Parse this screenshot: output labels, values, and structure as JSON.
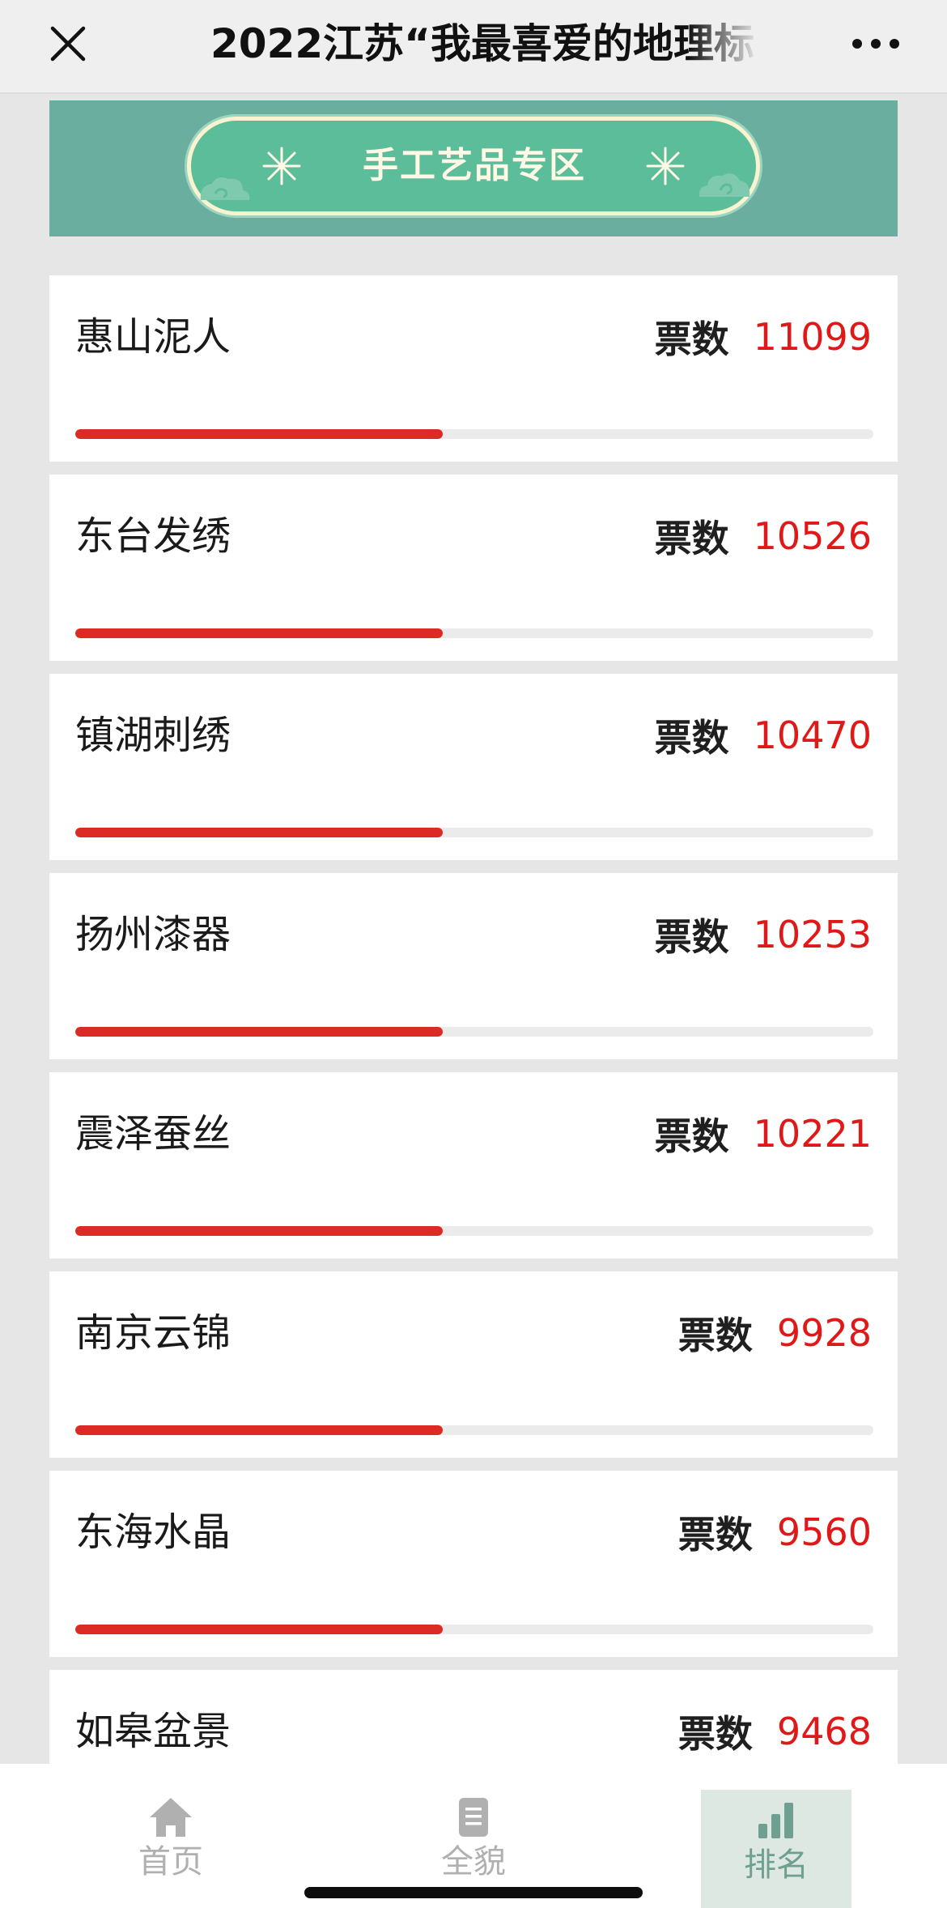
{
  "header": {
    "title": "2022江苏“我最喜爱的地理标",
    "close_icon": "close-icon",
    "more_icon": "more-icon"
  },
  "banner": {
    "title": "手工艺品专区",
    "colors": {
      "background": "#6aaea0",
      "pill": "#5bbd9a",
      "border": "#fbf2cf"
    }
  },
  "vote_label": "票数",
  "items": [
    {
      "name": "惠山泥人",
      "votes": "11099",
      "progress": 0.46
    },
    {
      "name": "东台发绣",
      "votes": "10526",
      "progress": 0.46
    },
    {
      "name": "镇湖刺绣",
      "votes": "10470",
      "progress": 0.46
    },
    {
      "name": "扬州漆器",
      "votes": "10253",
      "progress": 0.46
    },
    {
      "name": "震泽蚕丝",
      "votes": "10221",
      "progress": 0.46
    },
    {
      "name": "南京云锦",
      "votes": "9928",
      "progress": 0.46
    },
    {
      "name": "东海水晶",
      "votes": "9560",
      "progress": 0.46
    },
    {
      "name": "如皋盆景",
      "votes": "9468",
      "progress": 0.46
    }
  ],
  "nav": [
    {
      "label": "首页",
      "icon": "home-icon",
      "active": false
    },
    {
      "label": "全貌",
      "icon": "document-icon",
      "active": false
    },
    {
      "label": "排名",
      "icon": "bar-chart-icon",
      "active": true
    }
  ],
  "colors": {
    "accent_red": "#e01818",
    "bar_fill": "#dc2b24",
    "nav_active": "#6f9f91"
  }
}
